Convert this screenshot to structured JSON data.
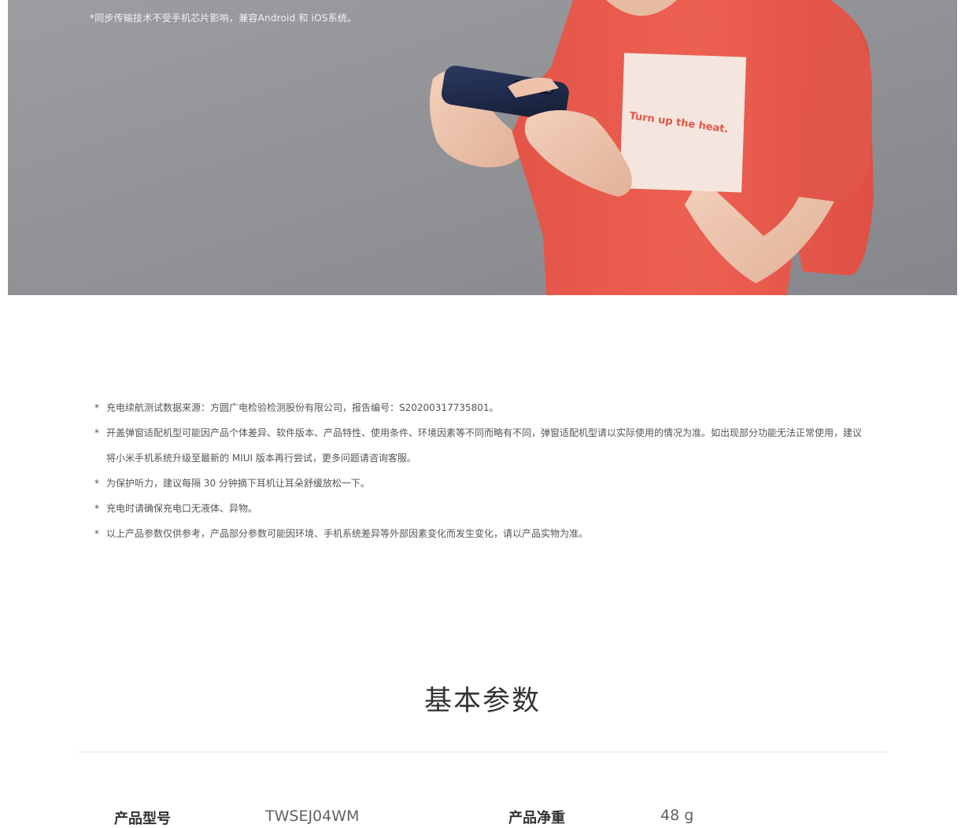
{
  "hero": {
    "footnote": "*同步传输技术不受手机芯片影响，兼容Android 和 iOS系统。",
    "shirt_print": "Turn up the heat."
  },
  "notes": {
    "bullet": "*",
    "items": [
      "充电续航测试数据来源：方圆广电检验检测股份有限公司，报告编号：S20200317735801。",
      "开盖弹窗适配机型可能因产品个体差异、软件版本、产品特性、使用条件、环境因素等不同而略有不同，弹窗适配机型请以实际使用的情况为准。如出现部分功能无法正常使用，建议将小米手机系统升级至最新的 MIUI 版本再行尝试，更多问题请咨询客服。",
      "为保护听力，建议每隔 30 分钟摘下耳机让耳朵舒缓放松一下。",
      "充电时请确保充电口无液体、异物。",
      "以上产品参数仅供参考，产品部分参数可能因环境、手机系统差异等外部因素变化而发生变化，请以产品实物为准。"
    ]
  },
  "specs": {
    "title": "基本参数",
    "model_label": "产品型号",
    "model_value": "TWSEJ04WM",
    "weight_label": "产品净重",
    "weight_value": "48 g"
  },
  "colors": {
    "shirt": "#e8584c",
    "background_grey": "#8e8f93",
    "phone": "#1f2a4a"
  }
}
